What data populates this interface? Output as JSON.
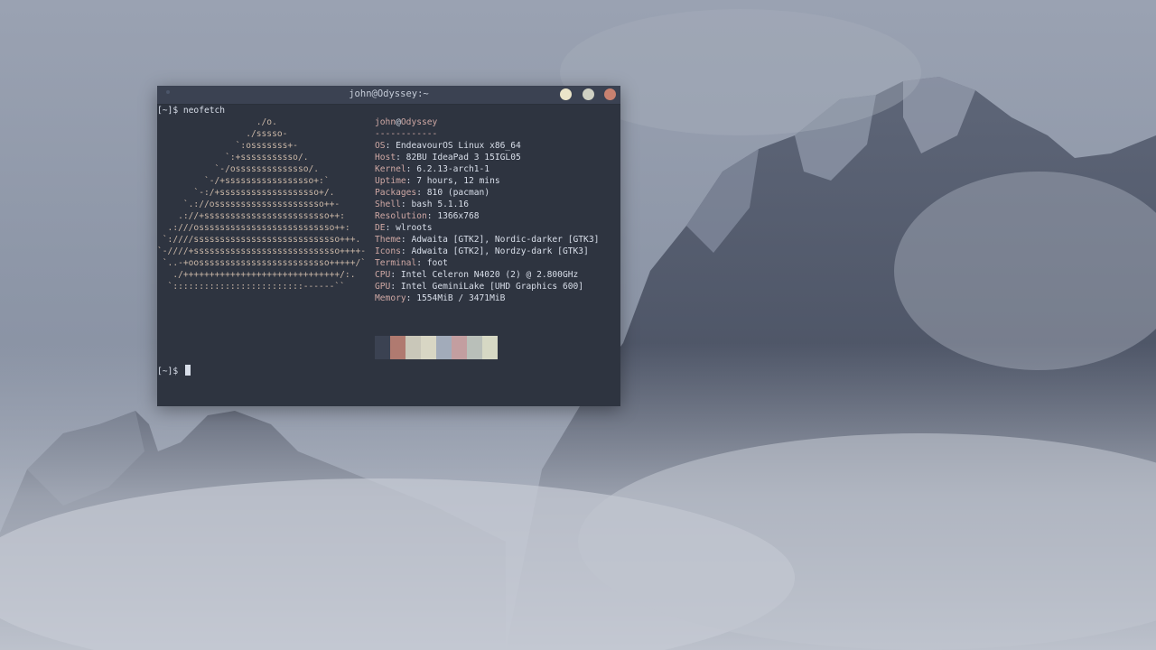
{
  "window": {
    "title": "john@Odyssey:~",
    "first_prompt": "[~]$ neofetch",
    "last_prompt": "[~]$ "
  },
  "logo": [
    "                   ./o.",
    "                 ./sssso-",
    "               `:osssssss+-",
    "             `:+sssssssssso/.",
    "           `-/ossssssssssssso/.",
    "         `-/+sssssssssssssssso+:`",
    "       `-:/+sssssssssssssssssso+/.",
    "     `.://osssssssssssssssssssso++-",
    "    .://+ssssssssssssssssssssssso++:",
    "  .:///ossssssssssssssssssssssssso++:",
    " `:////ssssssssssssssssssssssssssso+++.",
    "`-////+ssssssssssssssssssssssssssso++++-",
    " `..-+oosssssssssssssssssssssssso+++++/`",
    "   ./++++++++++++++++++++++++++++++/:.",
    "  `:::::::::::::::::::::::::------``"
  ],
  "info": {
    "userhost": {
      "user": "john",
      "at": "@",
      "host": "Odyssey"
    },
    "separator": "------------",
    "rows": [
      {
        "key": "OS",
        "value": "EndeavourOS Linux x86_64"
      },
      {
        "key": "Host",
        "value": "82BU IdeaPad 3 15IGL05"
      },
      {
        "key": "Kernel",
        "value": "6.2.13-arch1-1"
      },
      {
        "key": "Uptime",
        "value": "7 hours, 12 mins"
      },
      {
        "key": "Packages",
        "value": "810 (pacman)"
      },
      {
        "key": "Shell",
        "value": "bash 5.1.16"
      },
      {
        "key": "Resolution",
        "value": "1366x768"
      },
      {
        "key": "DE",
        "value": "wlroots"
      },
      {
        "key": "Theme",
        "value": "Adwaita [GTK2], Nordic-darker [GTK3]"
      },
      {
        "key": "Icons",
        "value": "Adwaita [GTK2], Nordzy-dark [GTK3]"
      },
      {
        "key": "Terminal",
        "value": "foot"
      },
      {
        "key": "CPU",
        "value": "Intel Celeron N4020 (2) @ 2.800GHz"
      },
      {
        "key": "GPU",
        "value": "Intel GeminiLake [UHD Graphics 600]"
      },
      {
        "key": "Memory",
        "value": "1554MiB / 3471MiB"
      }
    ],
    "palette": [
      "#3b4252",
      "#b07a70",
      "#c9c7b9",
      "#d8d6c4",
      "#a2abba",
      "#c39ea0",
      "#b9bfb9",
      "#d6d8c4"
    ]
  },
  "colors": {
    "terminal_bg": "#2e3440",
    "titlebar_bg": "#3b4252",
    "accent": "#cfa8a4",
    "close_button": "#c88170"
  }
}
